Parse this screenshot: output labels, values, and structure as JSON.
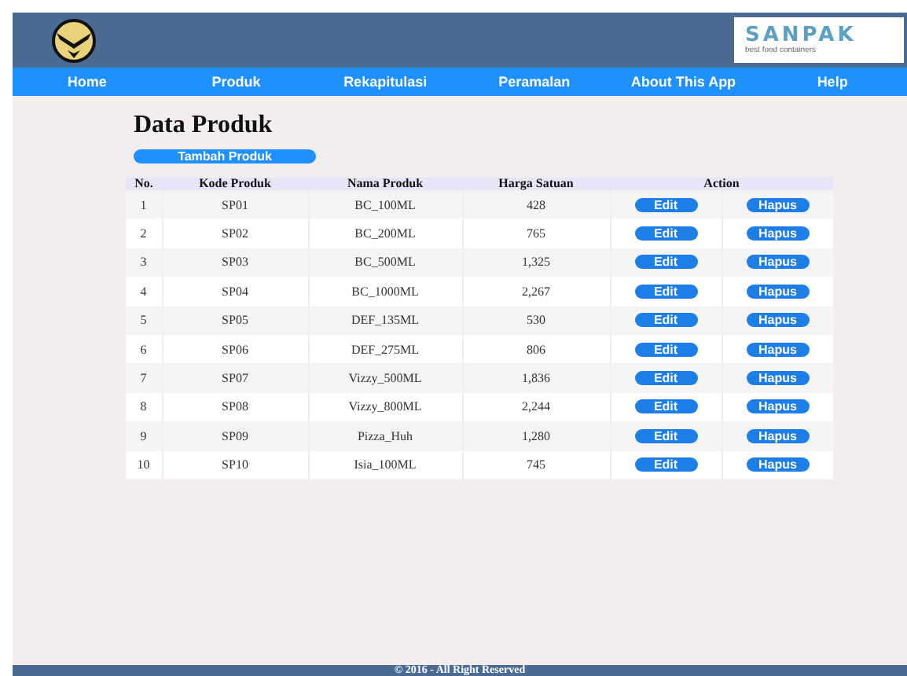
{
  "header": {
    "brand": {
      "name": "SANPAK",
      "tagline": "best food containers"
    }
  },
  "nav": [
    {
      "label": "Home"
    },
    {
      "label": "Produk"
    },
    {
      "label": "Rekapitulasi"
    },
    {
      "label": "Peramalan"
    },
    {
      "label": "About This App"
    },
    {
      "label": "Help"
    }
  ],
  "page": {
    "title": "Data Produk",
    "add_button": "Tambah Produk"
  },
  "table": {
    "columns": [
      "No.",
      "Kode Produk",
      "Nama Produk",
      "Harga Satuan",
      "Action"
    ],
    "rows": [
      {
        "no": "1",
        "code": "SP01",
        "name": "BC_100ML",
        "price": "428",
        "edit": "Edit",
        "delete": "Hapus"
      },
      {
        "no": "2",
        "code": "SP02",
        "name": "BC_200ML",
        "price": "765",
        "edit": "Edit",
        "delete": "Hapus"
      },
      {
        "no": "3",
        "code": "SP03",
        "name": "BC_500ML",
        "price": "1,325",
        "edit": "Edit",
        "delete": "Hapus"
      },
      {
        "no": "4",
        "code": "SP04",
        "name": "BC_1000ML",
        "price": "2,267",
        "edit": "Edit",
        "delete": "Hapus"
      },
      {
        "no": "5",
        "code": "SP05",
        "name": "DEF_135ML",
        "price": "530",
        "edit": "Edit",
        "delete": "Hapus"
      },
      {
        "no": "6",
        "code": "SP06",
        "name": "DEF_275ML",
        "price": "806",
        "edit": "Edit",
        "delete": "Hapus"
      },
      {
        "no": "7",
        "code": "SP07",
        "name": "Vizzy_500ML",
        "price": "1,836",
        "edit": "Edit",
        "delete": "Hapus"
      },
      {
        "no": "8",
        "code": "SP08",
        "name": "Vizzy_800ML",
        "price": "2,244",
        "edit": "Edit",
        "delete": "Hapus"
      },
      {
        "no": "9",
        "code": "SP09",
        "name": "Pizza_Huh",
        "price": "1,280",
        "edit": "Edit",
        "delete": "Hapus"
      },
      {
        "no": "10",
        "code": "SP10",
        "name": "Isia_100ML",
        "price": "745",
        "edit": "Edit",
        "delete": "Hapus"
      }
    ]
  },
  "footer": {
    "text": "© 2016 - All Right Reserved"
  }
}
